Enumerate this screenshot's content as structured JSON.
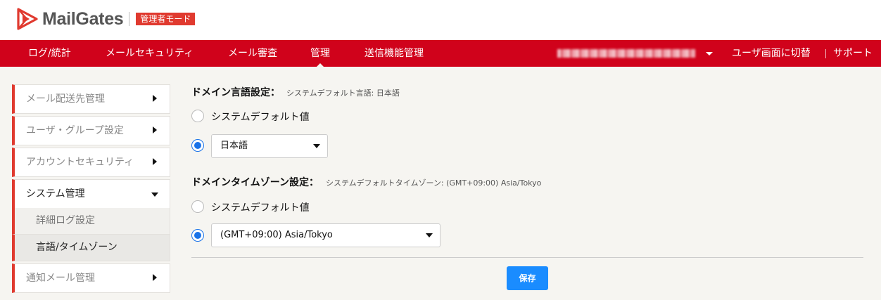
{
  "header": {
    "logo_text": "MailGates",
    "mode_badge": "管理者モード"
  },
  "nav": {
    "items": [
      "ログ/統計",
      "メールセキュリティ",
      "メール審査",
      "管理",
      "送信機能管理"
    ],
    "active_index": 3,
    "switch_user": "ユーザ画面に切替",
    "support": "サポート"
  },
  "sidebar": {
    "items": [
      {
        "label": "メール配送先管理"
      },
      {
        "label": "ユーザ・グループ設定"
      },
      {
        "label": "アカウントセキュリティ"
      },
      {
        "label": "システム管理",
        "expanded": true
      },
      {
        "label": "通知メール管理"
      }
    ],
    "sub_items": [
      {
        "label": "詳細ログ設定"
      },
      {
        "label": "言語/タイムゾーン",
        "selected": true
      }
    ]
  },
  "language": {
    "title": "ドメイン言語設定：",
    "note": "システムデフォルト言語: 日本語",
    "option_default": "システムデフォルト値",
    "selected_value": "日本語"
  },
  "timezone": {
    "title": "ドメインタイムゾーン設定：",
    "note": "システムデフォルトタイムゾーン: (GMT+09:00) Asia/Tokyo",
    "option_default": "システムデフォルト値",
    "selected_value": "(GMT+09:00) Asia/Tokyo"
  },
  "actions": {
    "save": "保存"
  },
  "colors": {
    "brand_red": "#d0021b",
    "accent_blue": "#1a8cff"
  }
}
